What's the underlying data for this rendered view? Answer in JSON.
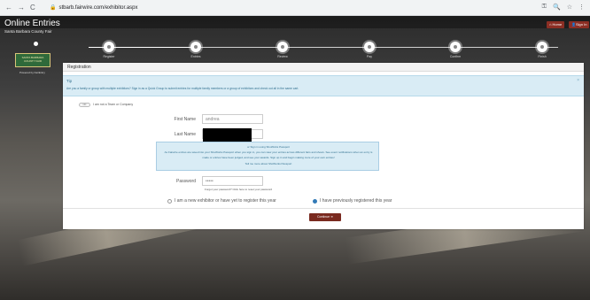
{
  "browser": {
    "back": "←",
    "forward": "→",
    "reload": "C",
    "url": "stbarb.fairwire.com/exhibitor.aspx"
  },
  "header": {
    "title": "Online Entries",
    "subtitle": "Santa Barbara County Fair",
    "home_label": "Home",
    "signin_label": "Sign In"
  },
  "steps": [
    {
      "label": "Register"
    },
    {
      "label": "Entries"
    },
    {
      "label": "Review"
    },
    {
      "label": "Pay"
    },
    {
      "label": "Confirm"
    },
    {
      "label": "Finish"
    }
  ],
  "logo": {
    "line1": "SANTA BARBARA",
    "line2": "COUNTY FAIR",
    "powered": "Powered by FairEntry"
  },
  "panel": {
    "title": "Registration",
    "tip_title": "Tip",
    "tip_text": "Are you a family or group with multiple exhibitors? Sign in as a Quick Group to submit entries for multiple family members or a group of exhibitors and check out all in the same cart.",
    "toggle_label": "NO",
    "toggle_text": "I am not a Team or Company",
    "first_name_label": "First Name",
    "first_name_value": "andrea",
    "last_name_label": "Last Name",
    "info_link": "or Sign in using ShoWorks Passport",
    "info_line1": "As Fairwire entries are saved into your ShoWorks Passport when you sign in, you can view your entries across different fairs and shows. See event notifications when an entry is",
    "info_line2": "made or entries have been judged, and see your awards. Sign up in and begin making more of your own entries!",
    "info_line3": "Tell me more about ShoWorks Passport",
    "password_label": "Password",
    "password_value": "•••••",
    "forgot_text": "Forgot your password? Click here to reset your password",
    "radio1_label": "I am a new exhibitor or have yet to register this year",
    "radio2_label": "I have previously registered this year",
    "continue_label": "Continue ➜"
  }
}
